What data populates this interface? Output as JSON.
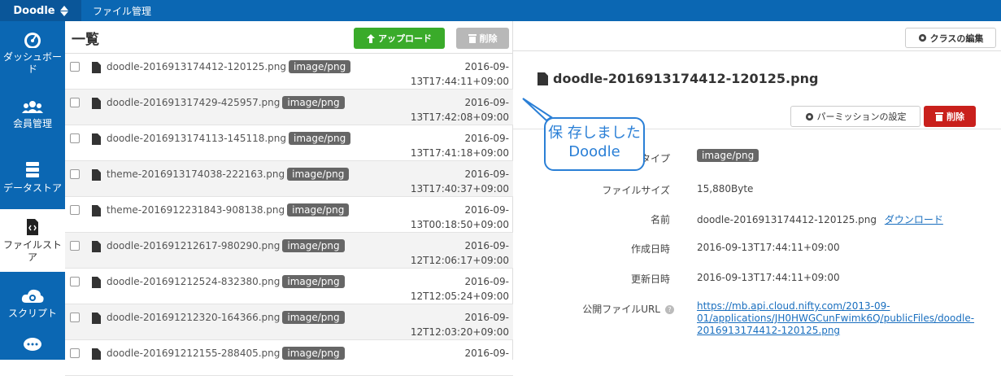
{
  "app": {
    "name": "Doodle"
  },
  "header": {
    "section": "ファイル管理"
  },
  "sidebar": {
    "items": [
      {
        "label": "ダッシュボード",
        "icon": "dashboard-icon"
      },
      {
        "label": "会員管理",
        "icon": "users-icon"
      },
      {
        "label": "データストア",
        "icon": "database-icon"
      },
      {
        "label": "ファイルストア",
        "icon": "file-code-icon"
      },
      {
        "label": "スクリプト",
        "icon": "cloud-gear-icon"
      }
    ],
    "active_index": 3
  },
  "list": {
    "title": "一覧",
    "upload_label": "アップロード",
    "delete_label": "削除",
    "rows": [
      {
        "name": "doodle-2016913174412-120125.png",
        "type": "image/png",
        "date1": "2016-09-",
        "date2": "13T17:44:11+09:00"
      },
      {
        "name": "doodle-201691317429-425957.png",
        "type": "image/png",
        "date1": "2016-09-",
        "date2": "13T17:42:08+09:00"
      },
      {
        "name": "doodle-2016913174113-145118.png",
        "type": "image/png",
        "date1": "2016-09-",
        "date2": "13T17:41:18+09:00"
      },
      {
        "name": "theme-2016913174038-222163.png",
        "type": "image/png",
        "date1": "2016-09-",
        "date2": "13T17:40:37+09:00"
      },
      {
        "name": "theme-2016912231843-908138.png",
        "type": "image/png",
        "date1": "2016-09-",
        "date2": "13T00:18:50+09:00"
      },
      {
        "name": "doodle-201691212617-980290.png",
        "type": "image/png",
        "date1": "2016-09-",
        "date2": "12T12:06:17+09:00"
      },
      {
        "name": "doodle-201691212524-832380.png",
        "type": "image/png",
        "date1": "2016-09-",
        "date2": "12T12:05:24+09:00"
      },
      {
        "name": "doodle-201691212320-164366.png",
        "type": "image/png",
        "date1": "2016-09-",
        "date2": "12T12:03:20+09:00"
      },
      {
        "name": "doodle-201691212155-288405.png",
        "type": "image/png",
        "date1": "2016-09-",
        "date2": ""
      }
    ]
  },
  "detail": {
    "class_edit_label": "クラスの編集",
    "title": "doodle-2016913174412-120125.png",
    "permission_label": "パーミッションの設定",
    "delete_label": "削除",
    "props": {
      "type_label": "タイプ",
      "type_value": "image/png",
      "size_label": "ファイルサイズ",
      "size_value": "15,880Byte",
      "name_label": "名前",
      "name_value": "doodle-2016913174412-120125.png",
      "download_label": "ダウンロード",
      "created_label": "作成日時",
      "created_value": "2016-09-13T17:44:11+09:00",
      "updated_label": "更新日時",
      "updated_value": "2016-09-13T17:44:11+09:00",
      "url_label": "公開ファイルURL",
      "url_line1": "https://mb.api.cloud.nifty.com/2013-09-",
      "url_line2": "01/applications/JH0HWGCunFwimk6Q/publicFiles/doodle-",
      "url_line3": "2016913174412-120125.png"
    }
  },
  "annotation": {
    "line1": "保 存しました",
    "line2": "Doodle"
  },
  "colors": {
    "brand": "#0b67b3",
    "upload": "#3aab2a",
    "danger": "#c9201c",
    "link": "#1a6fbf"
  }
}
